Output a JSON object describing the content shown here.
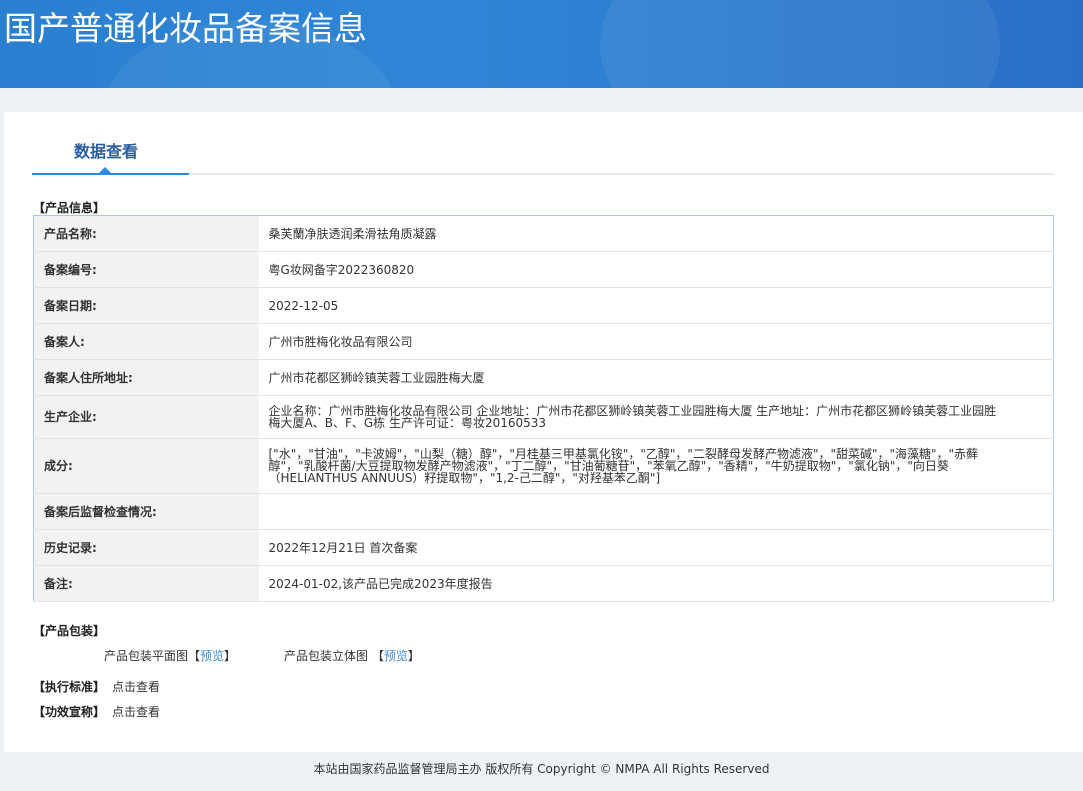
{
  "header": {
    "title": "国产普通化妆品备案信息"
  },
  "tab": {
    "label": "数据查看"
  },
  "product_info": {
    "section": "【产品信息】",
    "rows": [
      {
        "label": "产品名称:",
        "value": "桑芙蘭净肤透润柔滑祛角质凝露"
      },
      {
        "label": "备案编号:",
        "value": "粤G妆网备字2022360820"
      },
      {
        "label": "备案日期:",
        "value": "2022-12-05"
      },
      {
        "label": "备案人:",
        "value": "广州市胜梅化妆品有限公司"
      },
      {
        "label": "备案人住所地址:",
        "value": "广州市花都区狮岭镇芙蓉工业园胜梅大厦"
      },
      {
        "label": "生产企业:",
        "value": "企业名称：广州市胜梅化妆品有限公司 企业地址：广州市花都区狮岭镇芙蓉工业园胜梅大厦 生产地址：广州市花都区狮岭镇芙蓉工业园胜梅大厦A、B、F、G栋 生产许可证：粤妆20160533"
      },
      {
        "label": "成分:",
        "value": "[\"水\"，\"甘油\"，\"卡波姆\"，\"山梨（糖）醇\"，\"月桂基三甲基氯化铵\"，\"乙醇\"，\"二裂酵母发酵产物滤液\"，\"甜菜碱\"，\"海藻糖\"，\"赤藓醇\"，\"乳酸杆菌/大豆提取物发酵产物滤液\"，\"丁二醇\"，\"甘油葡糖苷\"，\"苯氧乙醇\"，\"香精\"，\"牛奶提取物\"，\"氯化钠\"，\"向日葵（HELIANTHUS ANNUUS）籽提取物\"，\"1,2-己二醇\"，\"对羟基苯乙酮\"]"
      },
      {
        "label": "备案后监督检查情况:",
        "value": ""
      },
      {
        "label": "历史记录:",
        "value": "2022年12月21日 首次备案"
      },
      {
        "label": "备注:",
        "value": "2024-01-02,该产品已完成2023年度报告"
      }
    ]
  },
  "packaging": {
    "section": "【产品包装】",
    "flat_label": "产品包装平面图",
    "flat_link": "预览",
    "solid_label": "产品包装立体图",
    "solid_link": "预览",
    "bl": "【",
    "br": "】"
  },
  "standard": {
    "section": "【执行标准】",
    "link": "点击查看"
  },
  "claims": {
    "section": "【功效宣称】",
    "link": "点击查看"
  },
  "footer": {
    "text": "本站由国家药品监督管理局主办 版权所有 Copyright © NMPA All Rights Reserved"
  }
}
